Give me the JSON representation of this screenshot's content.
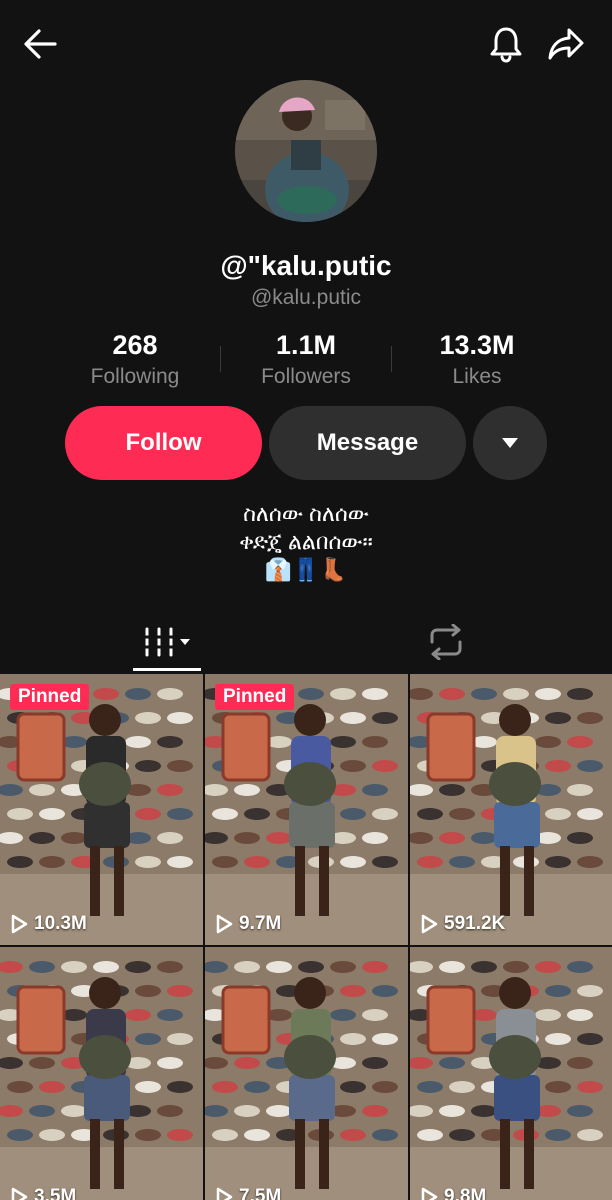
{
  "header": {
    "back_icon": "back-arrow-icon",
    "bell_icon": "notification-bell-icon",
    "share_icon": "share-arrow-icon"
  },
  "profile": {
    "display_name": "@\"kalu.putic",
    "handle": "@kalu.putic"
  },
  "stats": {
    "following": {
      "value": "268",
      "label": "Following"
    },
    "followers": {
      "value": "1.1M",
      "label": "Followers"
    },
    "likes": {
      "value": "13.3M",
      "label": "Likes"
    }
  },
  "actions": {
    "follow_label": "Follow",
    "message_label": "Message",
    "more_icon": "caret-down-icon"
  },
  "bio": {
    "line1": "ስለሰው ስለሰው",
    "line2": "ቀድጄ ልልበሰው።",
    "emoji": "👔👖👢"
  },
  "tabs": {
    "videos_icon": "grid-sort-icon",
    "repost_icon": "repost-icon"
  },
  "videos": [
    {
      "pinned": "Pinned",
      "views": "10.3M"
    },
    {
      "pinned": "Pinned",
      "views": "9.7M"
    },
    {
      "pinned": "",
      "views": "591.2K"
    },
    {
      "pinned": "",
      "views": "3.5M"
    },
    {
      "pinned": "",
      "views": "7.5M"
    },
    {
      "pinned": "",
      "views": "9.8M"
    }
  ],
  "colors": {
    "background": "#121212",
    "accent": "#fe2c55",
    "secondary_button": "#2f2f2f",
    "muted_text": "#8a8a8a"
  }
}
